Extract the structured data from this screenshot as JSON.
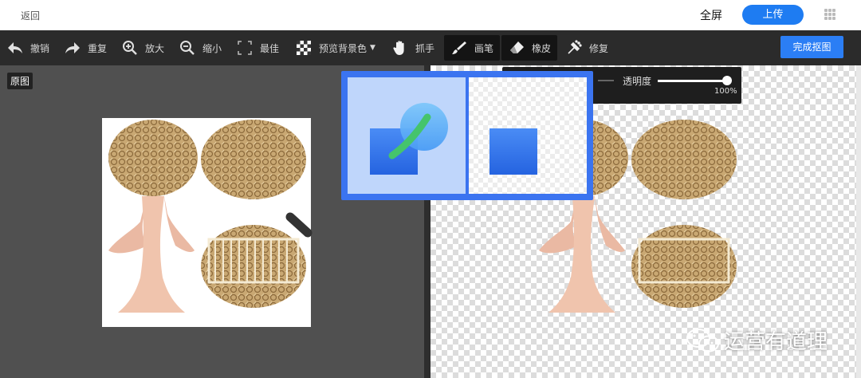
{
  "topbar": {
    "back_label": "返回",
    "fullscreen_label": "全屏",
    "upload_label": "上传",
    "apps_icon": "grid-icon"
  },
  "toolbar": {
    "items": [
      {
        "label": "撤销",
        "icon": "undo-icon"
      },
      {
        "label": "重复",
        "icon": "redo-icon"
      },
      {
        "label": "放大",
        "icon": "zoom-in-icon"
      },
      {
        "label": "缩小",
        "icon": "zoom-out-icon"
      },
      {
        "label": "最佳",
        "icon": "fit-icon"
      },
      {
        "label": "预览背景色",
        "icon": "checkerboard-icon"
      },
      {
        "label": "抓手",
        "icon": "hand-icon"
      },
      {
        "label": "画笔",
        "icon": "brush-icon",
        "active": true
      },
      {
        "label": "橡皮",
        "icon": "eraser-icon",
        "active": true
      },
      {
        "label": "修复",
        "icon": "repair-icon"
      }
    ],
    "done_label": "完成抠图"
  },
  "left_pane": {
    "label": "原图"
  },
  "opacity": {
    "label": "透明度",
    "value": "100%",
    "level": 1.0
  },
  "watermark": {
    "text": "运营有道理"
  },
  "colors": {
    "accent": "#2b7ef5",
    "toolbar_bg": "#2b2b2b",
    "left_bg": "#505050"
  }
}
